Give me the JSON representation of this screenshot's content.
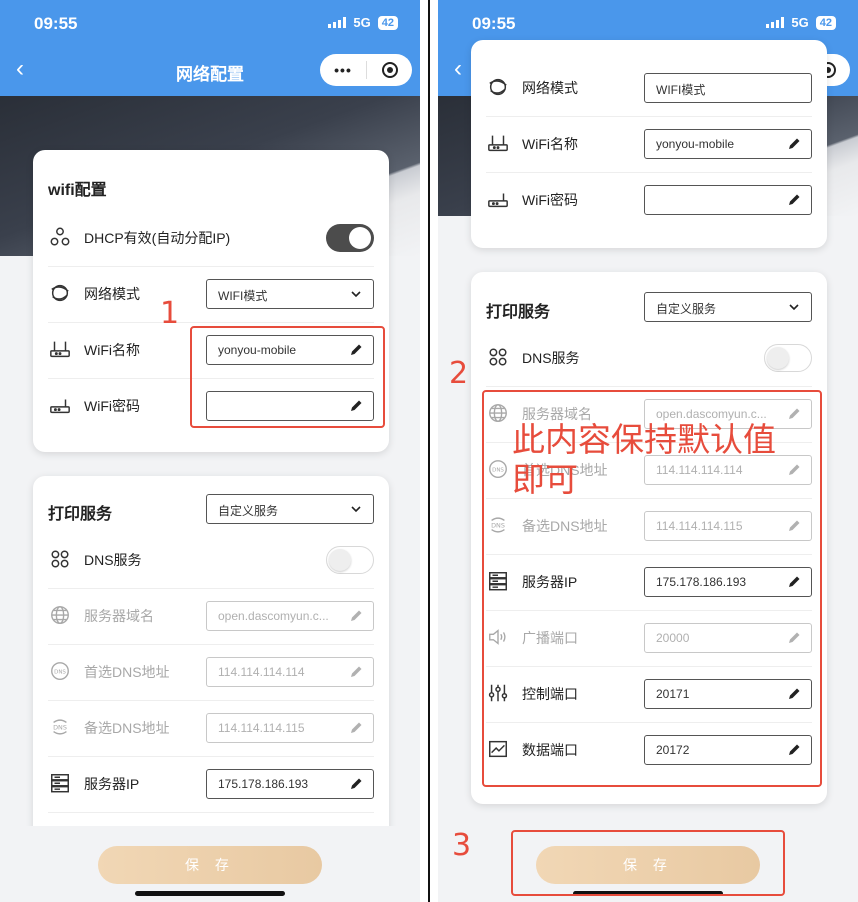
{
  "status": {
    "time": "09:55",
    "network": "5G",
    "battery": "42"
  },
  "nav": {
    "back": "‹",
    "title": "网络配置",
    "more": "•••"
  },
  "wifi_card": {
    "title": "wifi配置",
    "rows": [
      {
        "label": "DHCP有效(自动分配IP)",
        "icon": "dhcp-icon",
        "toggle": "on"
      },
      {
        "label": "网络模式",
        "icon": "network-mode-icon",
        "select": "WIFI模式"
      },
      {
        "label": "WiFi名称",
        "icon": "router-icon",
        "value": "yonyou-mobile"
      },
      {
        "label": "WiFi密码",
        "icon": "router-small-icon",
        "value": ""
      }
    ]
  },
  "print_card": {
    "title": "打印服务",
    "select": "自定义服务",
    "rows": [
      {
        "label": "DNS服务",
        "icon": "dns-service-icon",
        "toggle": "off"
      },
      {
        "label": "服务器域名",
        "icon": "globe-icon",
        "value": "open.dascomyun.c...",
        "disabled": true
      },
      {
        "label": "首选DNS地址",
        "icon": "dns-icon",
        "value": "114.114.114.114",
        "disabled": true
      },
      {
        "label": "备选DNS地址",
        "icon": "dns-alt-icon",
        "value": "114.114.114.115",
        "disabled": true
      },
      {
        "label": "服务器IP",
        "icon": "server-icon",
        "value": "175.178.186.193"
      },
      {
        "label": "广播端口",
        "icon": "speaker-icon",
        "value": "20000",
        "disabled": true
      },
      {
        "label": "控制端口",
        "icon": "sliders-icon",
        "value": "20171"
      },
      {
        "label": "数据端口",
        "icon": "chart-icon",
        "value": "20172"
      }
    ]
  },
  "save_label": "保 存",
  "annotations": {
    "one": "1",
    "two": "2",
    "three": "3",
    "note": "此内容保持默认值即可"
  },
  "colors": {
    "nav_blue": "#4a97eb",
    "annotation_red": "#e74c3c",
    "save_gold": "#ebcba5"
  }
}
